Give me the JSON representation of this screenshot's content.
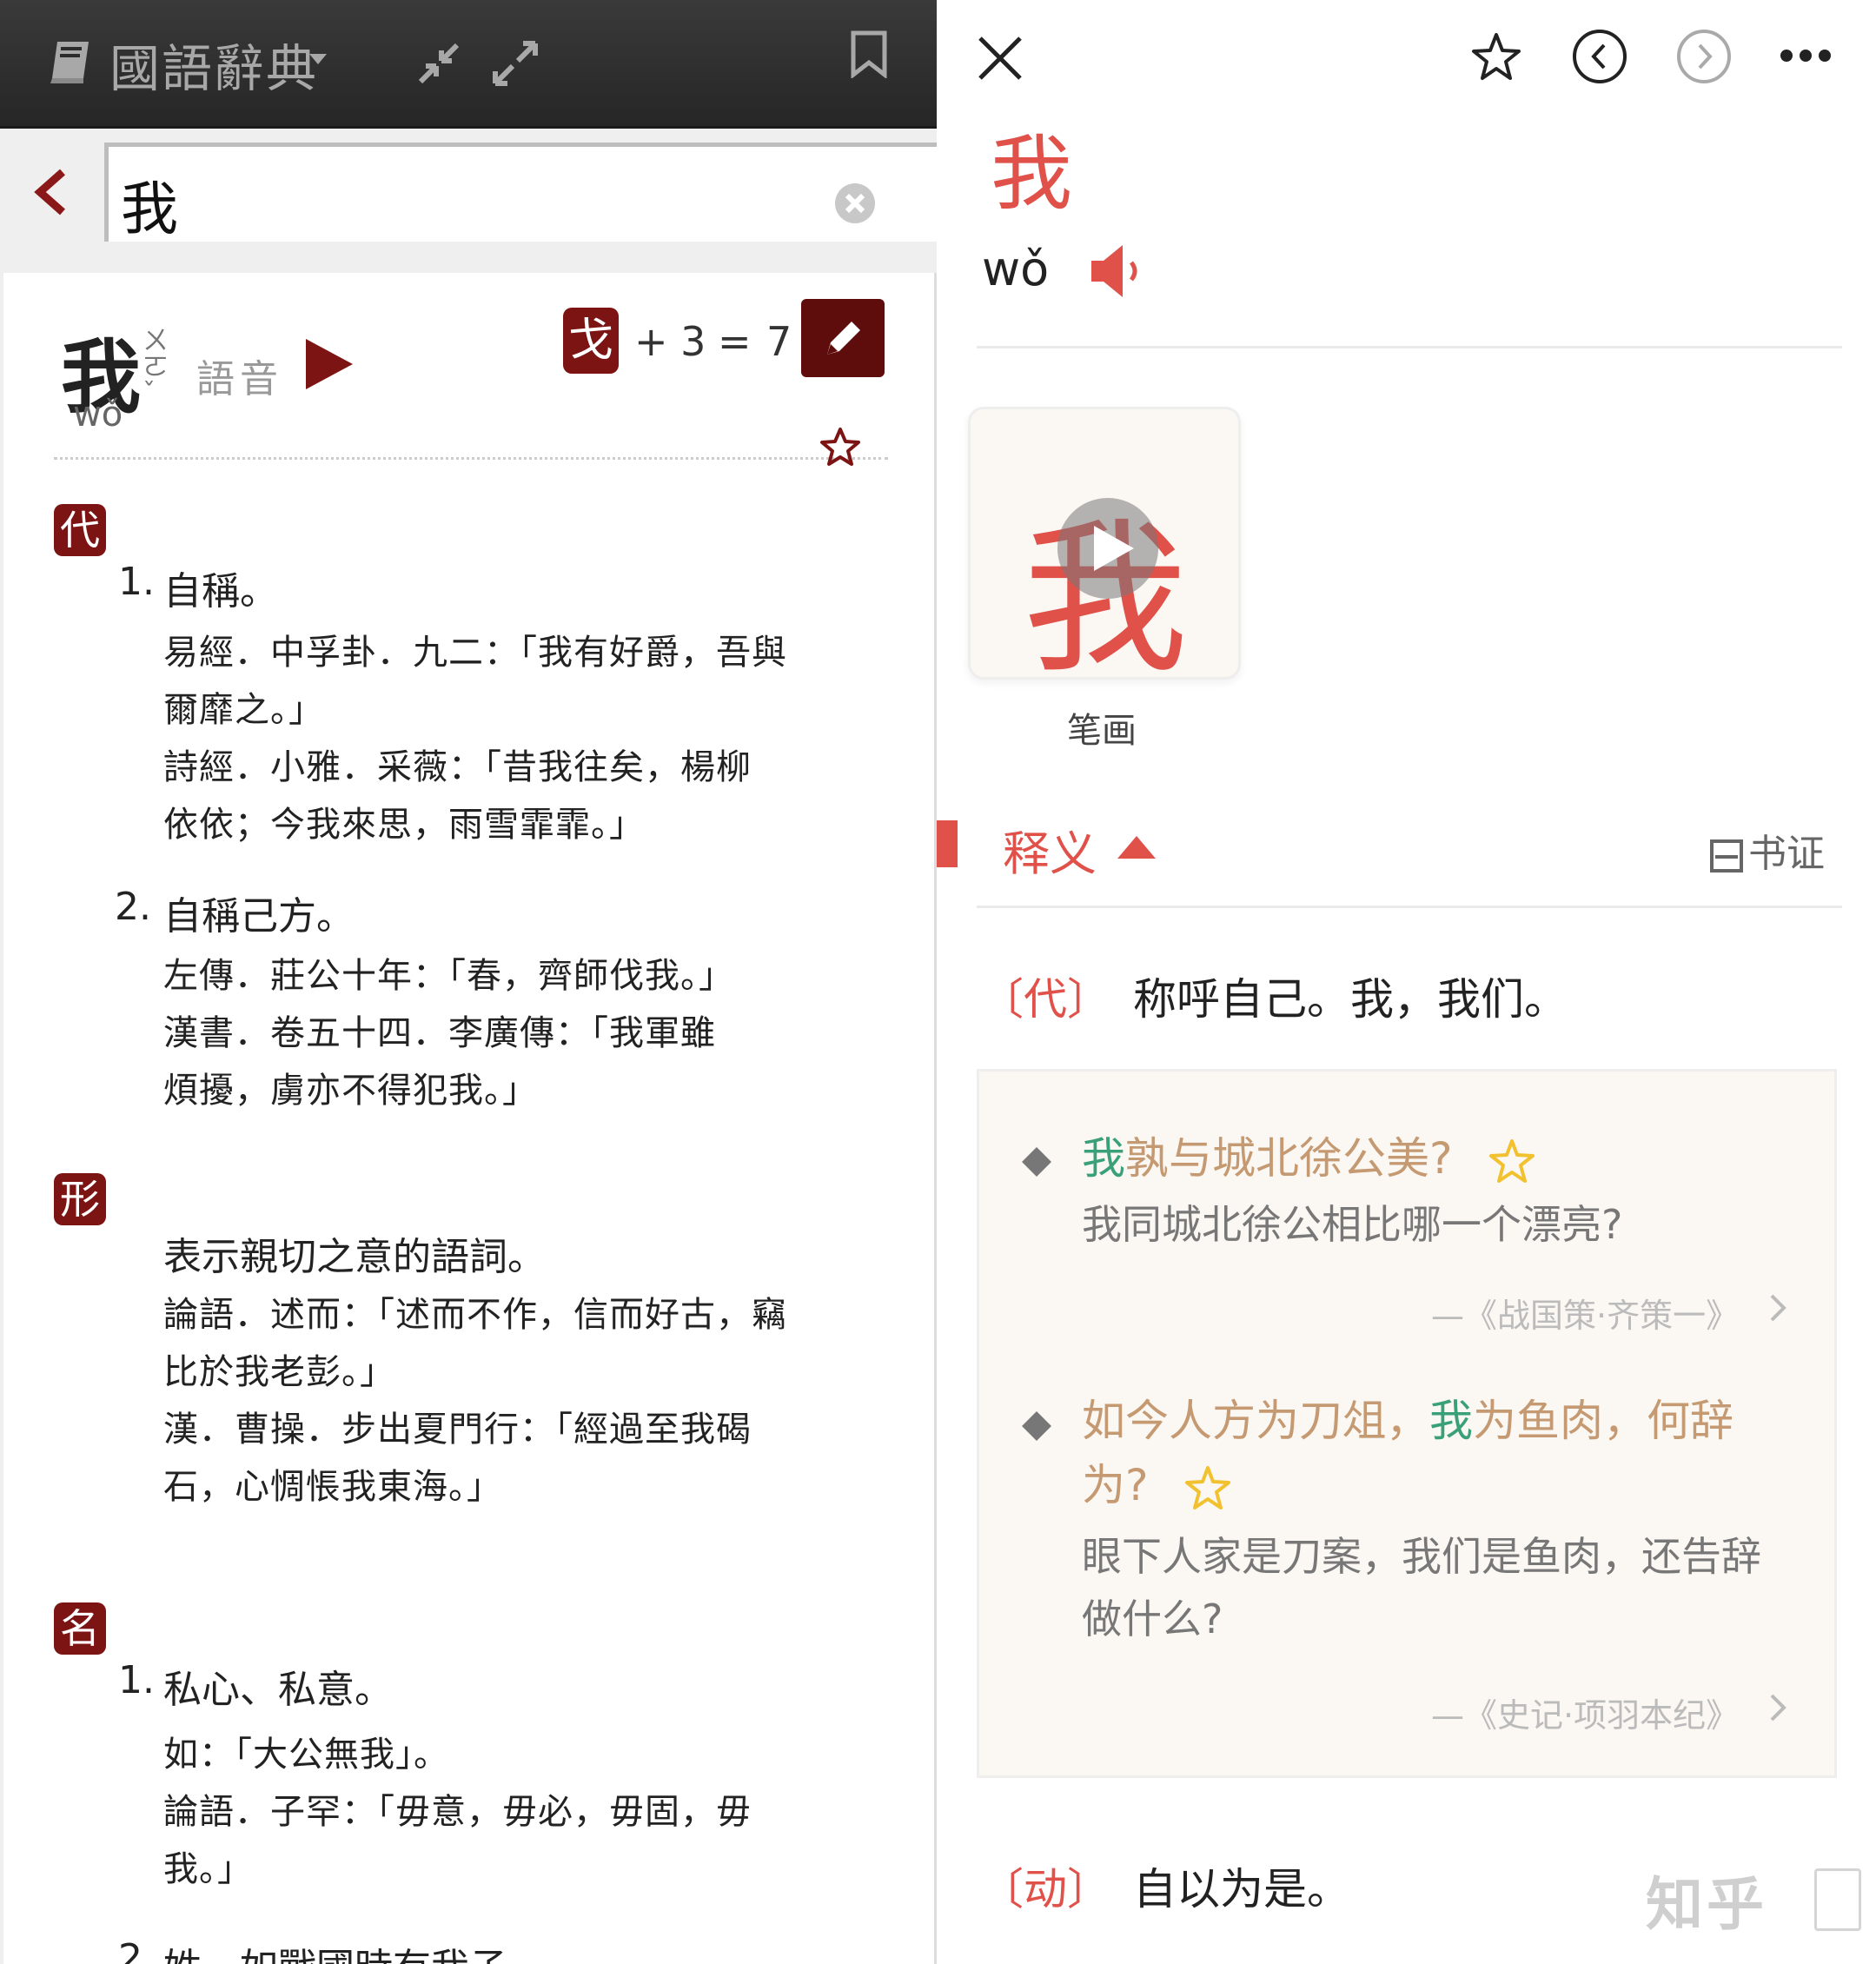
{
  "left": {
    "app_title": "國語辭典",
    "search_value": "我",
    "headword": {
      "char": "我",
      "zhuyin": "ㄨㄛˇ",
      "pinyin": "wǒ",
      "voice_label": "語音",
      "radical": "戈",
      "plus_strokes": "+ 3",
      "equals": "=",
      "total_strokes": "7"
    },
    "pos_sections": [
      {
        "pos": "代",
        "senses": [
          {
            "num": "1.",
            "def": "自稱。",
            "citations": [
              "易經．中孚卦．九二：「我有好爵，吾與",
              "爾靡之。」",
              "詩經．小雅．采薇：「昔我往矣，楊柳",
              "依依；今我來思，雨雪霏霏。」"
            ]
          },
          {
            "num": "2.",
            "def": "自稱己方。",
            "citations": [
              "左傳．莊公十年：「春，齊師伐我。」",
              "漢書．卷五十四．李廣傳：「我軍雖",
              "煩擾，虜亦不得犯我。」"
            ]
          }
        ]
      },
      {
        "pos": "形",
        "senses": [
          {
            "num": "",
            "def": "表示親切之意的語詞。",
            "citations": [
              "論語．述而：「述而不作，信而好古，竊",
              "比於我老彭。」",
              "漢．曹操．步出夏門行：「經過至我碣",
              "石，心惆悵我東海。」"
            ]
          }
        ]
      },
      {
        "pos": "名",
        "senses": [
          {
            "num": "1.",
            "def": "私心、私意。",
            "citations": [
              "如：「大公無我」。",
              "論語．子罕：「毋意，毋必，毋固，毋",
              "我。」"
            ]
          },
          {
            "num": "2.",
            "def": "姓。如戰國時有我子。",
            "citations": []
          }
        ]
      }
    ]
  },
  "right": {
    "char": "我",
    "pinyin": "wǒ",
    "stroke_label": "笔画",
    "section_title": "释义",
    "section_right": "书证",
    "definitions": [
      {
        "pos": "〔代〕",
        "text": "称呼自己。我，我们。",
        "examples": [
          {
            "quote_hl": "我",
            "quote_rest": "孰与城北徐公美?",
            "translation": "我同城北徐公相比哪一个漂亮?",
            "source": "—《战国策·齐策一》"
          },
          {
            "quote_pre": "如今人方为刀俎，",
            "quote_hl": "我",
            "quote_rest_1": "为鱼肉，何辞",
            "quote_rest_2": "为?",
            "translation_1": "眼下人家是刀案，我们是鱼肉，还告辞",
            "translation_2": "做什么?",
            "source": "—《史记·项羽本纪》"
          }
        ]
      },
      {
        "pos": "〔动〕",
        "text": "自以为是。"
      }
    ],
    "watermark": "知乎"
  },
  "colors": {
    "left_accent": "#7d1414",
    "right_accent": "#e0514a",
    "example_highlight": "#3aa07a",
    "example_text": "#c59a72",
    "star": "#f2c130"
  }
}
